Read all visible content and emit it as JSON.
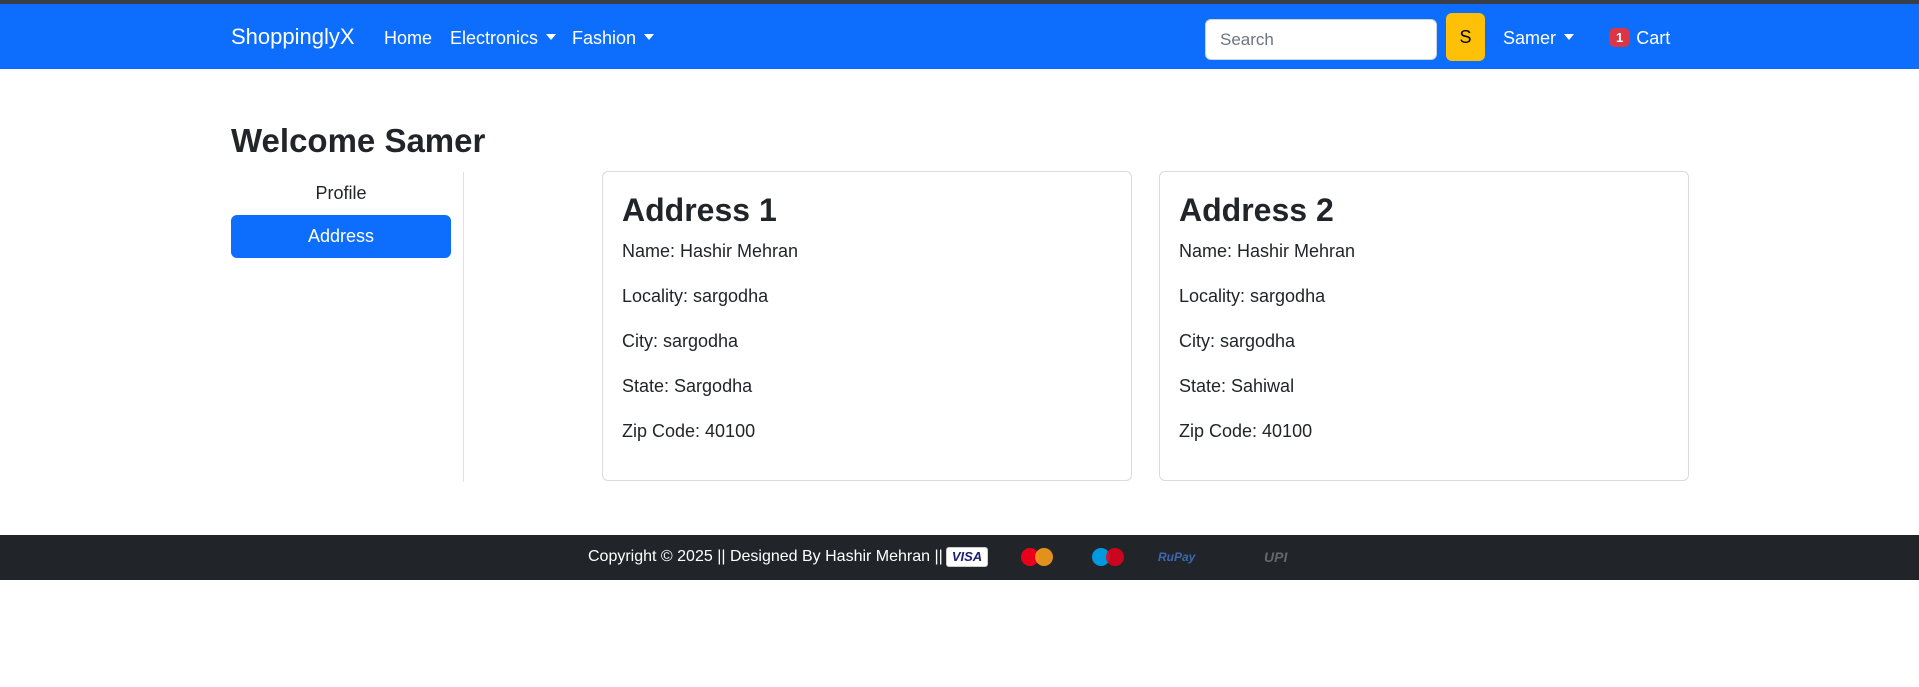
{
  "navbar": {
    "brand": "ShoppinglyX",
    "links": [
      {
        "label": "Home",
        "dropdown": false
      },
      {
        "label": "Electronics",
        "dropdown": true
      },
      {
        "label": "Fashion",
        "dropdown": true
      }
    ],
    "search": {
      "placeholder": "Search",
      "value": "",
      "button_label": "S"
    },
    "user": {
      "label": "Samer",
      "dropdown": true
    },
    "cart": {
      "label": "Cart",
      "count": "1"
    }
  },
  "page": {
    "title": "Welcome Samer"
  },
  "sidebar": {
    "items": [
      {
        "label": "Profile",
        "active": false
      },
      {
        "label": "Address",
        "active": true
      }
    ]
  },
  "addresses": [
    {
      "title": "Address 1",
      "name": "Name: Hashir Mehran",
      "locality": "Locality: sargodha",
      "city": "City: sargodha",
      "state": "State: Sargodha",
      "zip": "Zip Code: 40100"
    },
    {
      "title": "Address 2",
      "name": "Name: Hashir Mehran",
      "locality": "Locality: sargodha",
      "city": "City: sargodha",
      "state": "State: Sahiwal",
      "zip": "Zip Code: 40100"
    }
  ],
  "footer": {
    "text": "Copyright © 2025 || Designed By Hashir Mehran ||",
    "payment_logos": [
      "visa-logo",
      "mastercard-logo",
      "maestro-logo",
      "rupay-logo",
      "upi-logo"
    ],
    "visa": "VISA",
    "rupay": "RuPay",
    "upi": "UPI"
  },
  "colors": {
    "primary": "#0d6efd",
    "warning": "#ffc107",
    "danger": "#dc3545",
    "footer_bg": "#212529"
  }
}
